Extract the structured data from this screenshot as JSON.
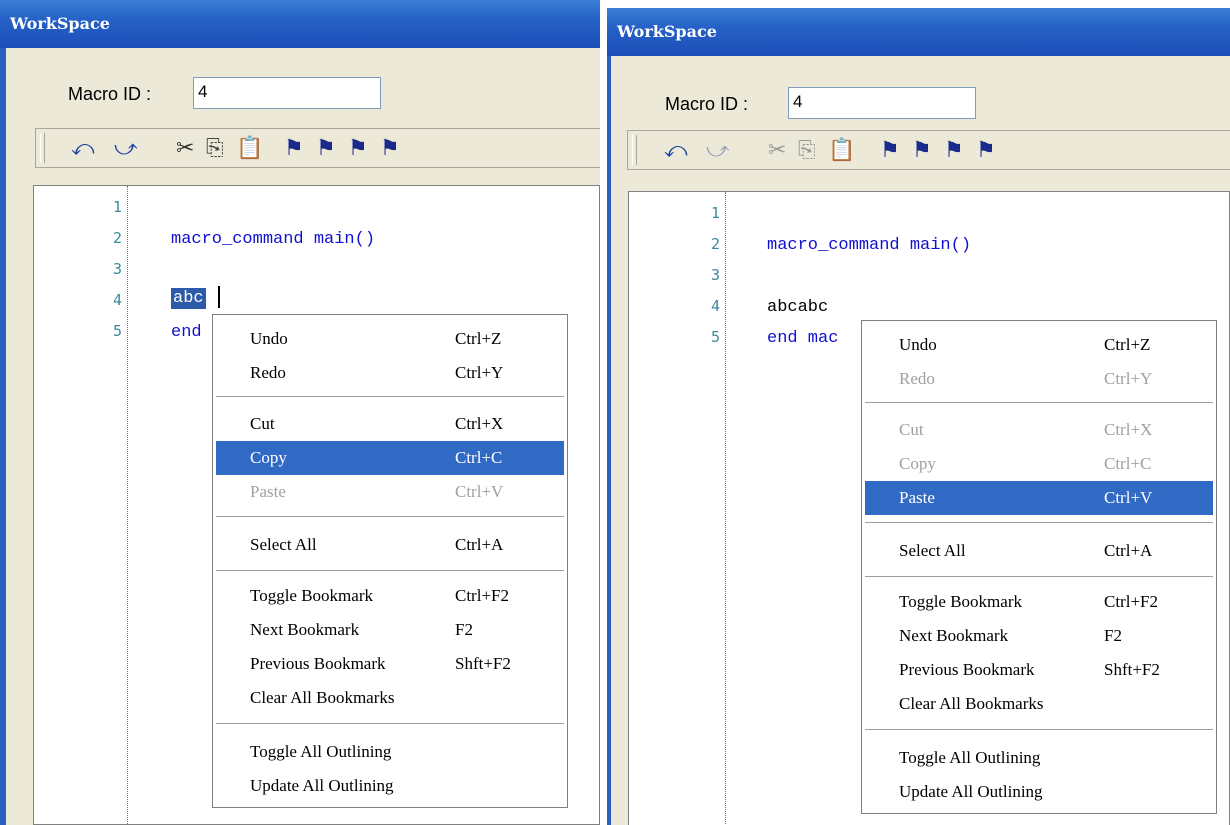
{
  "panels": [
    {
      "title": "WorkSpace",
      "macro_label": "Macro ID :",
      "macro_value": "4",
      "lines": [
        {
          "num": "1",
          "text": "",
          "cls": "txt"
        },
        {
          "num": "2",
          "text": "macro_command main()",
          "cls": "kw"
        },
        {
          "num": "3",
          "text": "",
          "cls": "txt"
        },
        {
          "num": "4",
          "text": "abc",
          "cls": "sel"
        },
        {
          "num": "5",
          "text": "end",
          "cls": "kw"
        }
      ],
      "menu": {
        "undo": {
          "label": "Undo",
          "shortcut": "Ctrl+Z"
        },
        "redo": {
          "label": "Redo",
          "shortcut": "Ctrl+Y"
        },
        "cut": {
          "label": "Cut",
          "shortcut": "Ctrl+X"
        },
        "copy": {
          "label": "Copy",
          "shortcut": "Ctrl+C"
        },
        "paste": {
          "label": "Paste",
          "shortcut": "Ctrl+V"
        },
        "select_all": {
          "label": "Select All",
          "shortcut": "Ctrl+A"
        },
        "toggle_bookmark": {
          "label": "Toggle Bookmark",
          "shortcut": "Ctrl+F2"
        },
        "next_bookmark": {
          "label": "Next Bookmark",
          "shortcut": "F2"
        },
        "previous_bookmark": {
          "label": "Previous Bookmark",
          "shortcut": "Shft+F2"
        },
        "clear_bookmarks": {
          "label": "Clear All Bookmarks",
          "shortcut": ""
        },
        "toggle_outlining": {
          "label": "Toggle All Outlining",
          "shortcut": ""
        },
        "update_outlining": {
          "label": "Update All Outlining",
          "shortcut": ""
        }
      },
      "highlighted": "Copy",
      "disabled": [
        "Paste"
      ]
    },
    {
      "title": "WorkSpace",
      "macro_label": "Macro ID :",
      "macro_value": "4",
      "lines": [
        {
          "num": "1",
          "text": "",
          "cls": "txt"
        },
        {
          "num": "2",
          "text": "macro_command main()",
          "cls": "kw"
        },
        {
          "num": "3",
          "text": "",
          "cls": "txt"
        },
        {
          "num": "4",
          "text": "abcabc",
          "cls": "txt"
        },
        {
          "num": "5",
          "text": "end mac",
          "cls": "kw"
        }
      ],
      "menu": {
        "undo": {
          "label": "Undo",
          "shortcut": "Ctrl+Z"
        },
        "redo": {
          "label": "Redo",
          "shortcut": "Ctrl+Y"
        },
        "cut": {
          "label": "Cut",
          "shortcut": "Ctrl+X"
        },
        "copy": {
          "label": "Copy",
          "shortcut": "Ctrl+C"
        },
        "paste": {
          "label": "Paste",
          "shortcut": "Ctrl+V"
        },
        "select_all": {
          "label": "Select All",
          "shortcut": "Ctrl+A"
        },
        "toggle_bookmark": {
          "label": "Toggle Bookmark",
          "shortcut": "Ctrl+F2"
        },
        "next_bookmark": {
          "label": "Next Bookmark",
          "shortcut": "F2"
        },
        "previous_bookmark": {
          "label": "Previous Bookmark",
          "shortcut": "Shft+F2"
        },
        "clear_bookmarks": {
          "label": "Clear All Bookmarks",
          "shortcut": ""
        },
        "toggle_outlining": {
          "label": "Toggle All Outlining",
          "shortcut": ""
        },
        "update_outlining": {
          "label": "Update All Outlining",
          "shortcut": ""
        }
      },
      "highlighted": "Paste",
      "disabled": [
        "Redo",
        "Cut",
        "Copy"
      ]
    }
  ],
  "toolbar_icons": [
    "undo-icon",
    "redo-icon",
    "cut-icon",
    "copy-icon",
    "paste-icon",
    "bookmark-toggle-icon",
    "bookmark-next-icon",
    "bookmark-previous-icon",
    "bookmark-clear-icon"
  ],
  "colors": {
    "titlebar": "#2561c6",
    "keyword": "#1010d0",
    "highlight": "#316ac5",
    "disabled": "#a0a0a0",
    "line_numbers": "#3a8a9a"
  }
}
